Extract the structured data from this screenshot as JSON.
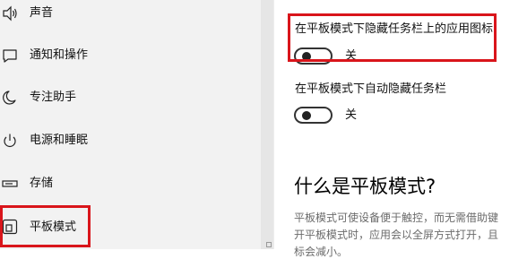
{
  "sidebar": {
    "items": [
      {
        "label": "声音",
        "icon": "speaker-icon"
      },
      {
        "label": "通知和操作",
        "icon": "message-icon"
      },
      {
        "label": "专注助手",
        "icon": "moon-icon"
      },
      {
        "label": "电源和睡眠",
        "icon": "power-icon"
      },
      {
        "label": "存储",
        "icon": "storage-icon"
      },
      {
        "label": "平板模式",
        "icon": "tablet-mode-icon"
      }
    ]
  },
  "settings": [
    {
      "label": "在平板模式下隐藏任务栏上的应用图标",
      "state": "关"
    },
    {
      "label": "在平板模式下自动隐藏任务栏",
      "state": "关"
    }
  ],
  "info": {
    "title": "什么是平板模式?",
    "lines": [
      "平板模式可使设备便于触控，而无需借助键",
      "开平板模式时，应用会以全屏方式打开，且",
      "标会减小。"
    ]
  },
  "colors": {
    "highlight": "#d9151b",
    "sidebar_bg": "#f2f2f2"
  }
}
